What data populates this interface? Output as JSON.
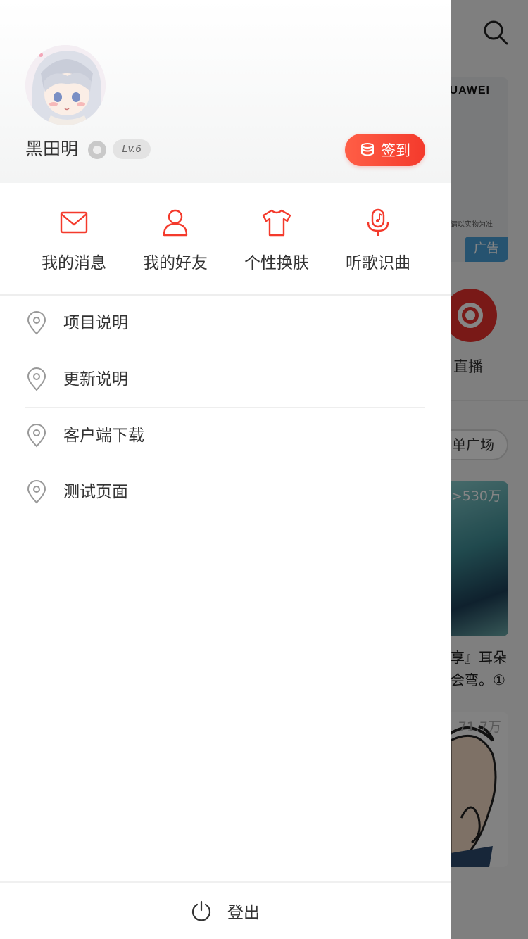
{
  "background_page": {
    "banner_brand": "HUAWEI",
    "banner_fine_print": "。请以实物为准",
    "banner_ad_badge": "广告",
    "live_label": "直播",
    "playlist_pill": "单广场",
    "card1_count": ">530万",
    "card_text_line1": "享』耳朵",
    "card_text_line2": "会弯。①",
    "card2_count": "71.7万"
  },
  "drawer": {
    "profile": {
      "username": "黑田明",
      "level": "Lv.6",
      "signin_label": "签到"
    },
    "quick_actions": [
      {
        "label": "我的消息",
        "icon": "mail-icon"
      },
      {
        "label": "我的好友",
        "icon": "user-icon"
      },
      {
        "label": "个性换肤",
        "icon": "tshirt-icon"
      },
      {
        "label": "听歌识曲",
        "icon": "microphone-music-icon"
      }
    ],
    "menu": [
      {
        "label": "项目说明",
        "icon": "location-pin-icon"
      },
      {
        "label": "更新说明",
        "icon": "location-pin-icon"
      },
      {
        "label": "客户端下载",
        "icon": "location-pin-icon"
      },
      {
        "label": "测试页面",
        "icon": "location-pin-icon"
      }
    ],
    "logout_label": "登出"
  },
  "colors": {
    "accent_red": "#f43a2c",
    "text": "#333333",
    "ad_blue": "#49a0d6"
  }
}
